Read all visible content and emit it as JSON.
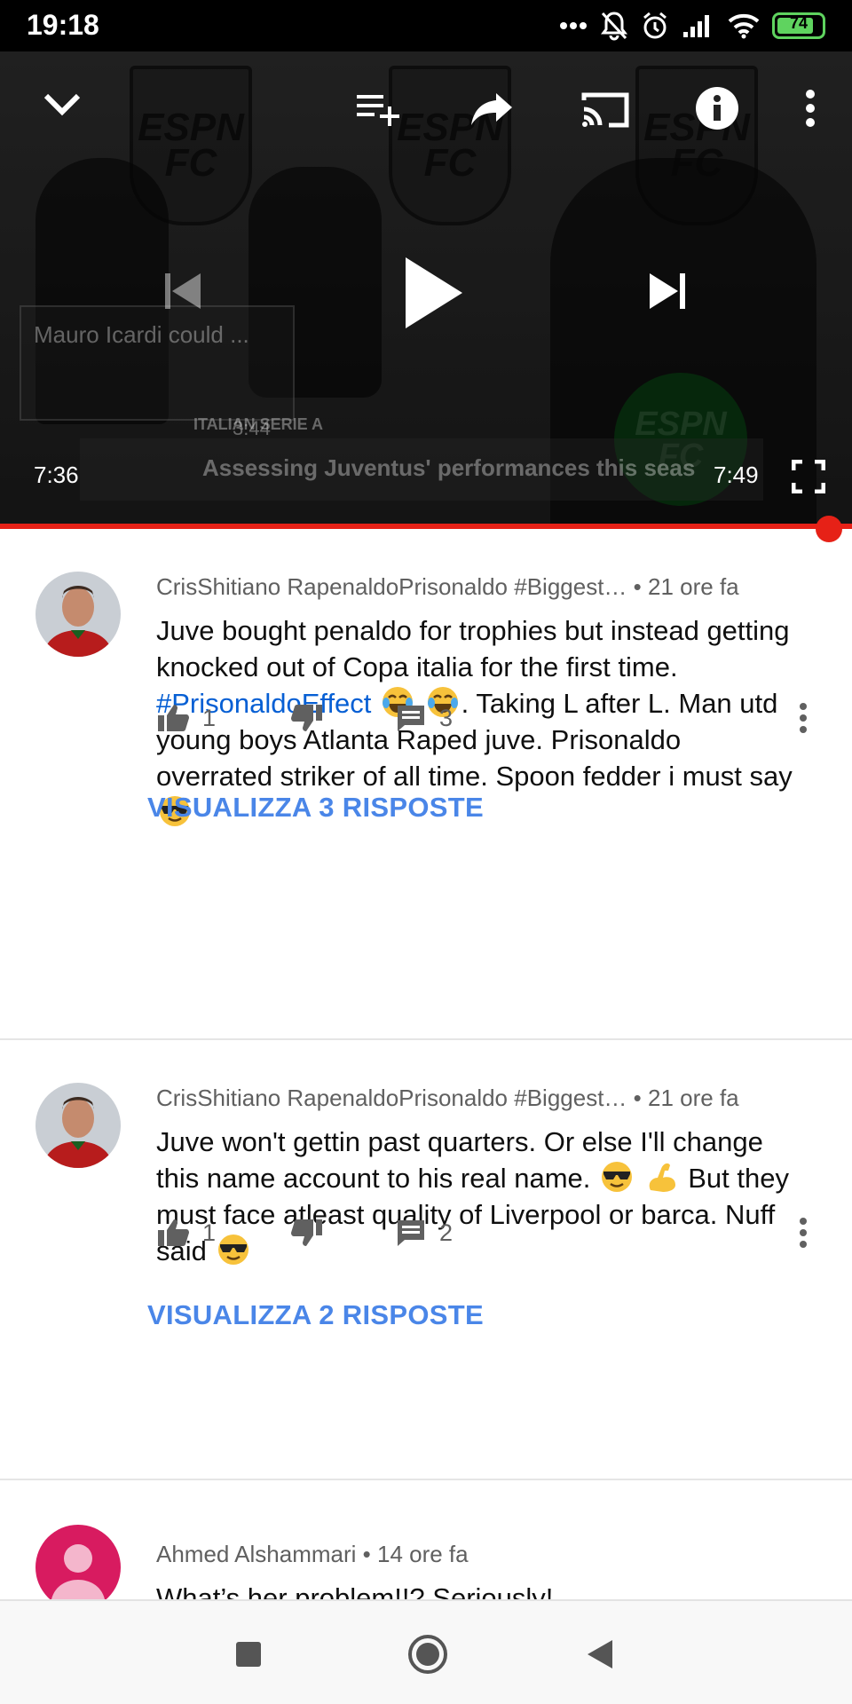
{
  "status_bar": {
    "time": "19:18",
    "battery": "74",
    "battery_color": "#5fd35f"
  },
  "player": {
    "current_time": "7:36",
    "duration": "7:49",
    "endscreen_title_1": "Mauro Icardi could ...",
    "endscreen_duration": "3:44",
    "endscreen_category": "ITALIAN SERIE A",
    "endscreen_title_2": "Assessing Juventus' performances this seas",
    "crest_text": "ESPN FC",
    "progress_percent": 97,
    "progress_color": "#e62117",
    "icons": [
      "chevron-down-icon",
      "add-to-queue-icon",
      "share-icon",
      "cast-icon",
      "info-icon",
      "more-vert-icon",
      "previous-icon",
      "play-icon",
      "next-icon",
      "fullscreen-icon"
    ]
  },
  "comments": [
    {
      "author": "CrisShitiano RapenaldoPrisonaldo #Biggest…",
      "age": "• 21 ore fa",
      "text_before_tag": "Juve bought penaldo for trophies but instead getting knocked out of Copa italia for the first time. ",
      "hashtag": "#PrisonaldoEffect",
      "text_after_tag": ". Taking L after L. Man utd young boys Atlanta Raped juve. Prisonaldo overrated striker of all time. Spoon fedder i must say",
      "likes": "1",
      "replies_count": "3",
      "view_replies": "VISUALIZZA 3 RISPOSTE"
    },
    {
      "author": "CrisShitiano RapenaldoPrisonaldo #Biggest…",
      "age": "• 21 ore fa",
      "text_part1": "Juve won't gettin past quarters. Or else I'll change this name account to his real name.",
      "text_part2": "But they must face atleast quality of Liverpool or barca. Nuff said",
      "likes": "1",
      "replies_count": "2",
      "view_replies": "VISUALIZZA 2 RISPOSTE"
    },
    {
      "author": "Ahmed Alshammari",
      "age": "• 14 ore fa",
      "text": "What’s her problem!!? Seriously!",
      "avatar_color": "#d81b60"
    }
  ],
  "colors": {
    "link": "#065fd4",
    "replies_link": "#4a86e8",
    "meta_text": "#606060"
  }
}
